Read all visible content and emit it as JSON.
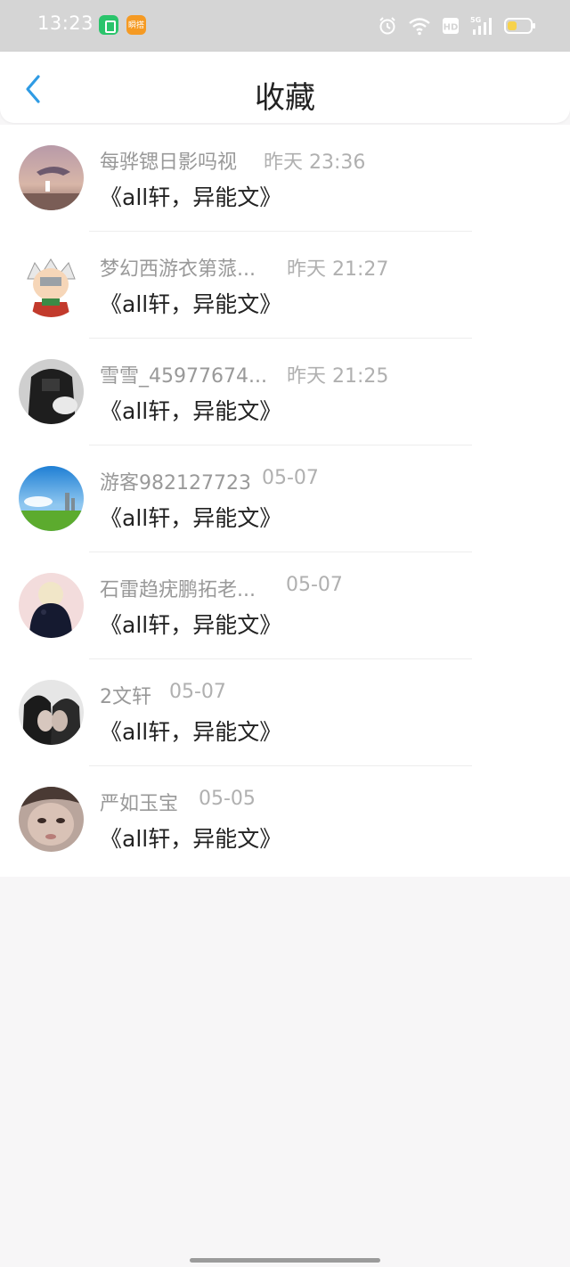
{
  "status_bar": {
    "time": "13:23",
    "badge_orange_label": "瞬搭",
    "icons": [
      "alarm-icon",
      "wifi-icon",
      "hd-icon",
      "signal-5g-icon",
      "battery-icon"
    ],
    "battery_level": 0.4
  },
  "header": {
    "back_icon": "chevron-left-icon",
    "title": "收藏",
    "accent_color": "#2f9be4"
  },
  "favorites": [
    {
      "name": "每骅锶日影吗视",
      "time": "昨天 23:36",
      "title": "《all轩，异能文》"
    },
    {
      "name": "梦幻西游衣第蒎...",
      "time": "昨天 21:27",
      "title": "《all轩，异能文》"
    },
    {
      "name": "雪雪_45977674...",
      "time": "昨天 21:25",
      "title": "《all轩，异能文》"
    },
    {
      "name": "游客982127723",
      "time": "05-07",
      "title": "《all轩，异能文》"
    },
    {
      "name": "石雷趋疣鹏拓老...",
      "time": "05-07",
      "title": "《all轩，异能文》"
    },
    {
      "name": "2文轩",
      "time": "05-07",
      "title": "《all轩，异能文》"
    },
    {
      "name": "严如玉宝",
      "time": "05-05",
      "title": "《all轩，异能文》"
    }
  ]
}
